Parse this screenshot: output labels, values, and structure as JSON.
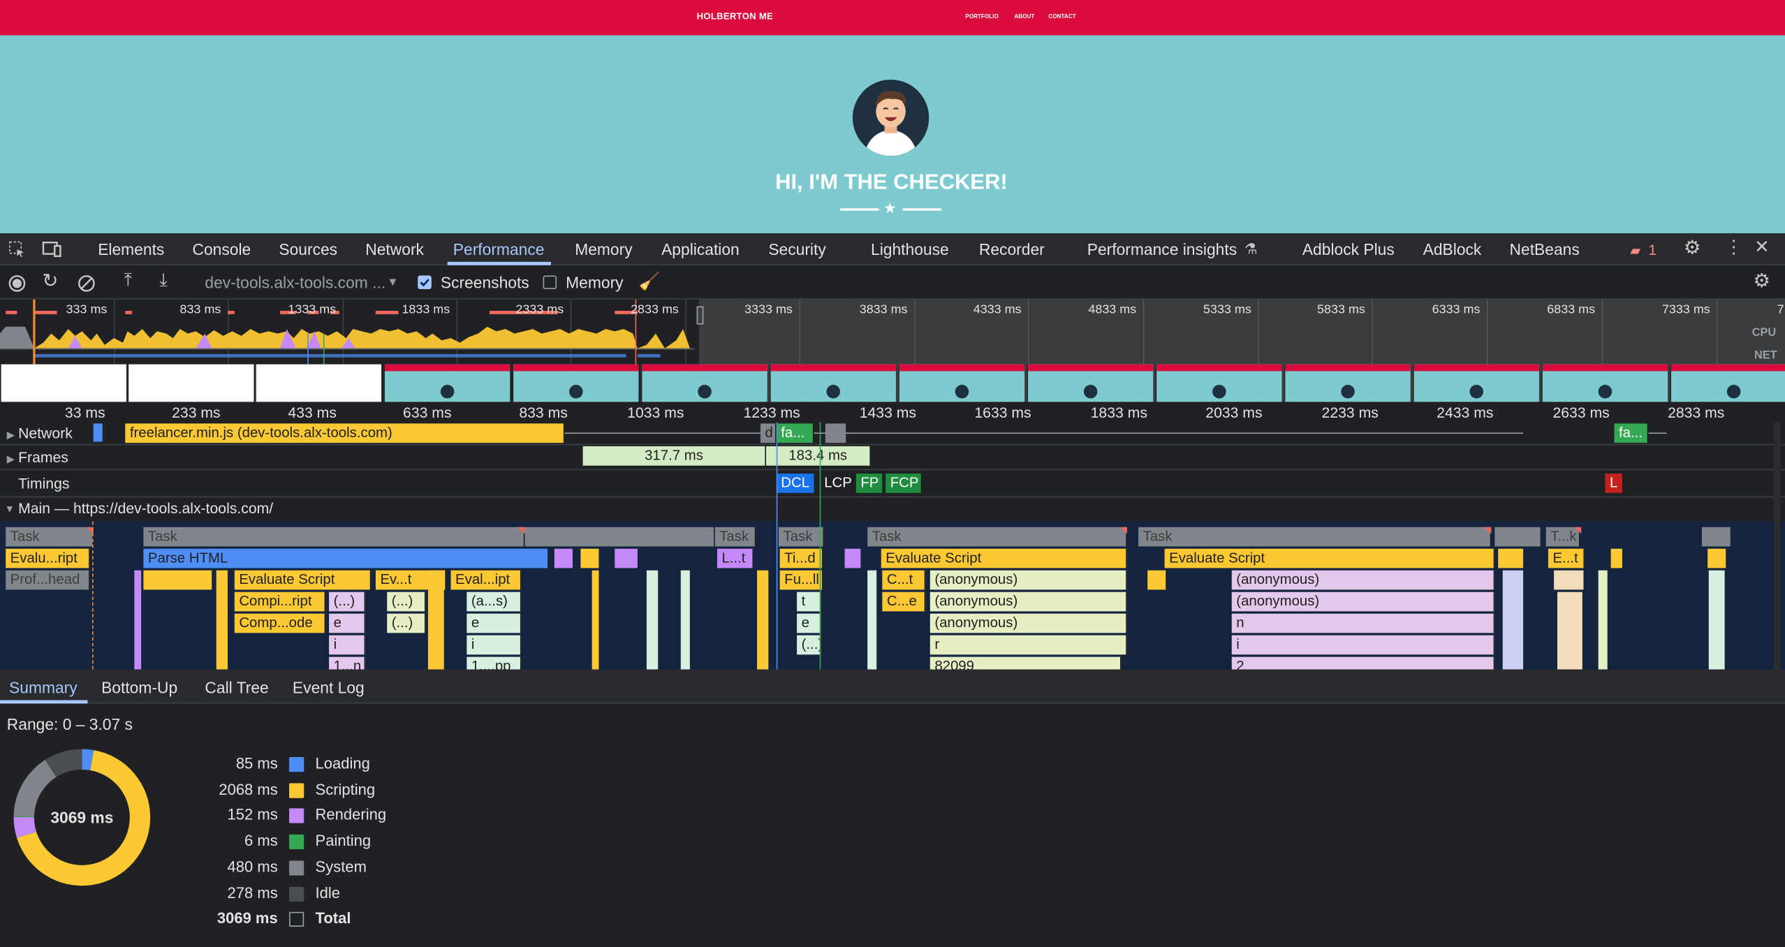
{
  "site": {
    "brand": "HOLBERTON ME",
    "links": [
      "PORTFOLIO",
      "ABOUT",
      "CONTACT"
    ],
    "hero_title": "HI, I'M THE CHECKER!",
    "colors": {
      "nav": "#dc0b3e",
      "hero_bg": "#7ecbcf"
    }
  },
  "devtools": {
    "tabs": [
      "Elements",
      "Console",
      "Sources",
      "Network",
      "Performance",
      "Memory",
      "Application",
      "Security",
      "Lighthouse",
      "Recorder",
      "Performance insights",
      "Adblock Plus",
      "AdBlock",
      "NetBeans"
    ],
    "active_tab": "Performance",
    "issues_count": "1",
    "toolbar": {
      "url": "dev-tools.alx-tools.com ...",
      "screenshots_label": "Screenshots",
      "screenshots_checked": true,
      "memory_label": "Memory",
      "memory_checked": false
    }
  },
  "overview": {
    "ticks": [
      "333 ms",
      "833 ms",
      "1333 ms",
      "1833 ms",
      "2333 ms",
      "2833 ms",
      "3333 ms",
      "3833 ms",
      "4333 ms",
      "4833 ms",
      "5333 ms",
      "5833 ms",
      "6333 ms",
      "6833 ms",
      "7333 ms",
      "7"
    ],
    "cpu_label": "CPU",
    "net_label": "NET"
  },
  "ruler": {
    "ticks": [
      "33 ms",
      "233 ms",
      "433 ms",
      "633 ms",
      "833 ms",
      "1033 ms",
      "1233 ms",
      "1433 ms",
      "1633 ms",
      "1833 ms",
      "2033 ms",
      "2233 ms",
      "2433 ms",
      "2633 ms",
      "2833 ms"
    ]
  },
  "tracks": {
    "network_label": "Network",
    "network_request": "freelancer.min.js (dev-tools.alx-tools.com)",
    "network_d": "d",
    "network_fa1": "fa...",
    "network_fa2": "fa...",
    "frames_label": "Frames",
    "frame1": "317.7 ms",
    "frame2": "183.4 ms",
    "timings_label": "Timings",
    "timings": [
      "DCL",
      "LCP",
      "FP",
      "FCP",
      "L"
    ],
    "main_label": "Main — https://dev-tools.alx-tools.com/"
  },
  "flame": {
    "task": "Task",
    "task_tk": "T...k",
    "eval_ript": "Evalu...ript",
    "prof_head": "Prof...head",
    "parse_html": "Parse HTML",
    "lt": "L...t",
    "tid": "Ti...d",
    "eval_script": "Evaluate Script",
    "et": "E...t",
    "evt": "Ev...t",
    "eval_ipt": "Eval...ipt",
    "ful": "Fu...ll",
    "ct": "C...t",
    "ce": "C...e",
    "anonymous": "(anonymous)",
    "compi_ript": "Compi...ript",
    "paren": "(...)",
    "as": "(a...s)",
    "t": "t",
    "comp_ode": "Comp...ode",
    "e": "e",
    "i": "i",
    "r": "r",
    "n": "n",
    "one_n": "1...n",
    "one_pp": "1....pp",
    "num_82099": "82099",
    "num_2": "2"
  },
  "bottom_tabs": [
    "Summary",
    "Bottom-Up",
    "Call Tree",
    "Event Log"
  ],
  "summary": {
    "range": "Range: 0 – 3.07 s",
    "total_center": "3069 ms",
    "rows": [
      {
        "ms": "85 ms",
        "label": "Loading",
        "color": "#4f8ef7"
      },
      {
        "ms": "2068 ms",
        "label": "Scripting",
        "color": "#fcc934"
      },
      {
        "ms": "152 ms",
        "label": "Rendering",
        "color": "#c58af9"
      },
      {
        "ms": "6 ms",
        "label": "Painting",
        "color": "#34a853"
      },
      {
        "ms": "480 ms",
        "label": "System",
        "color": "#80868b"
      },
      {
        "ms": "278 ms",
        "label": "Idle",
        "color": "#4a4d51"
      },
      {
        "ms": "3069 ms",
        "label": "Total",
        "color": "transparent"
      }
    ]
  }
}
